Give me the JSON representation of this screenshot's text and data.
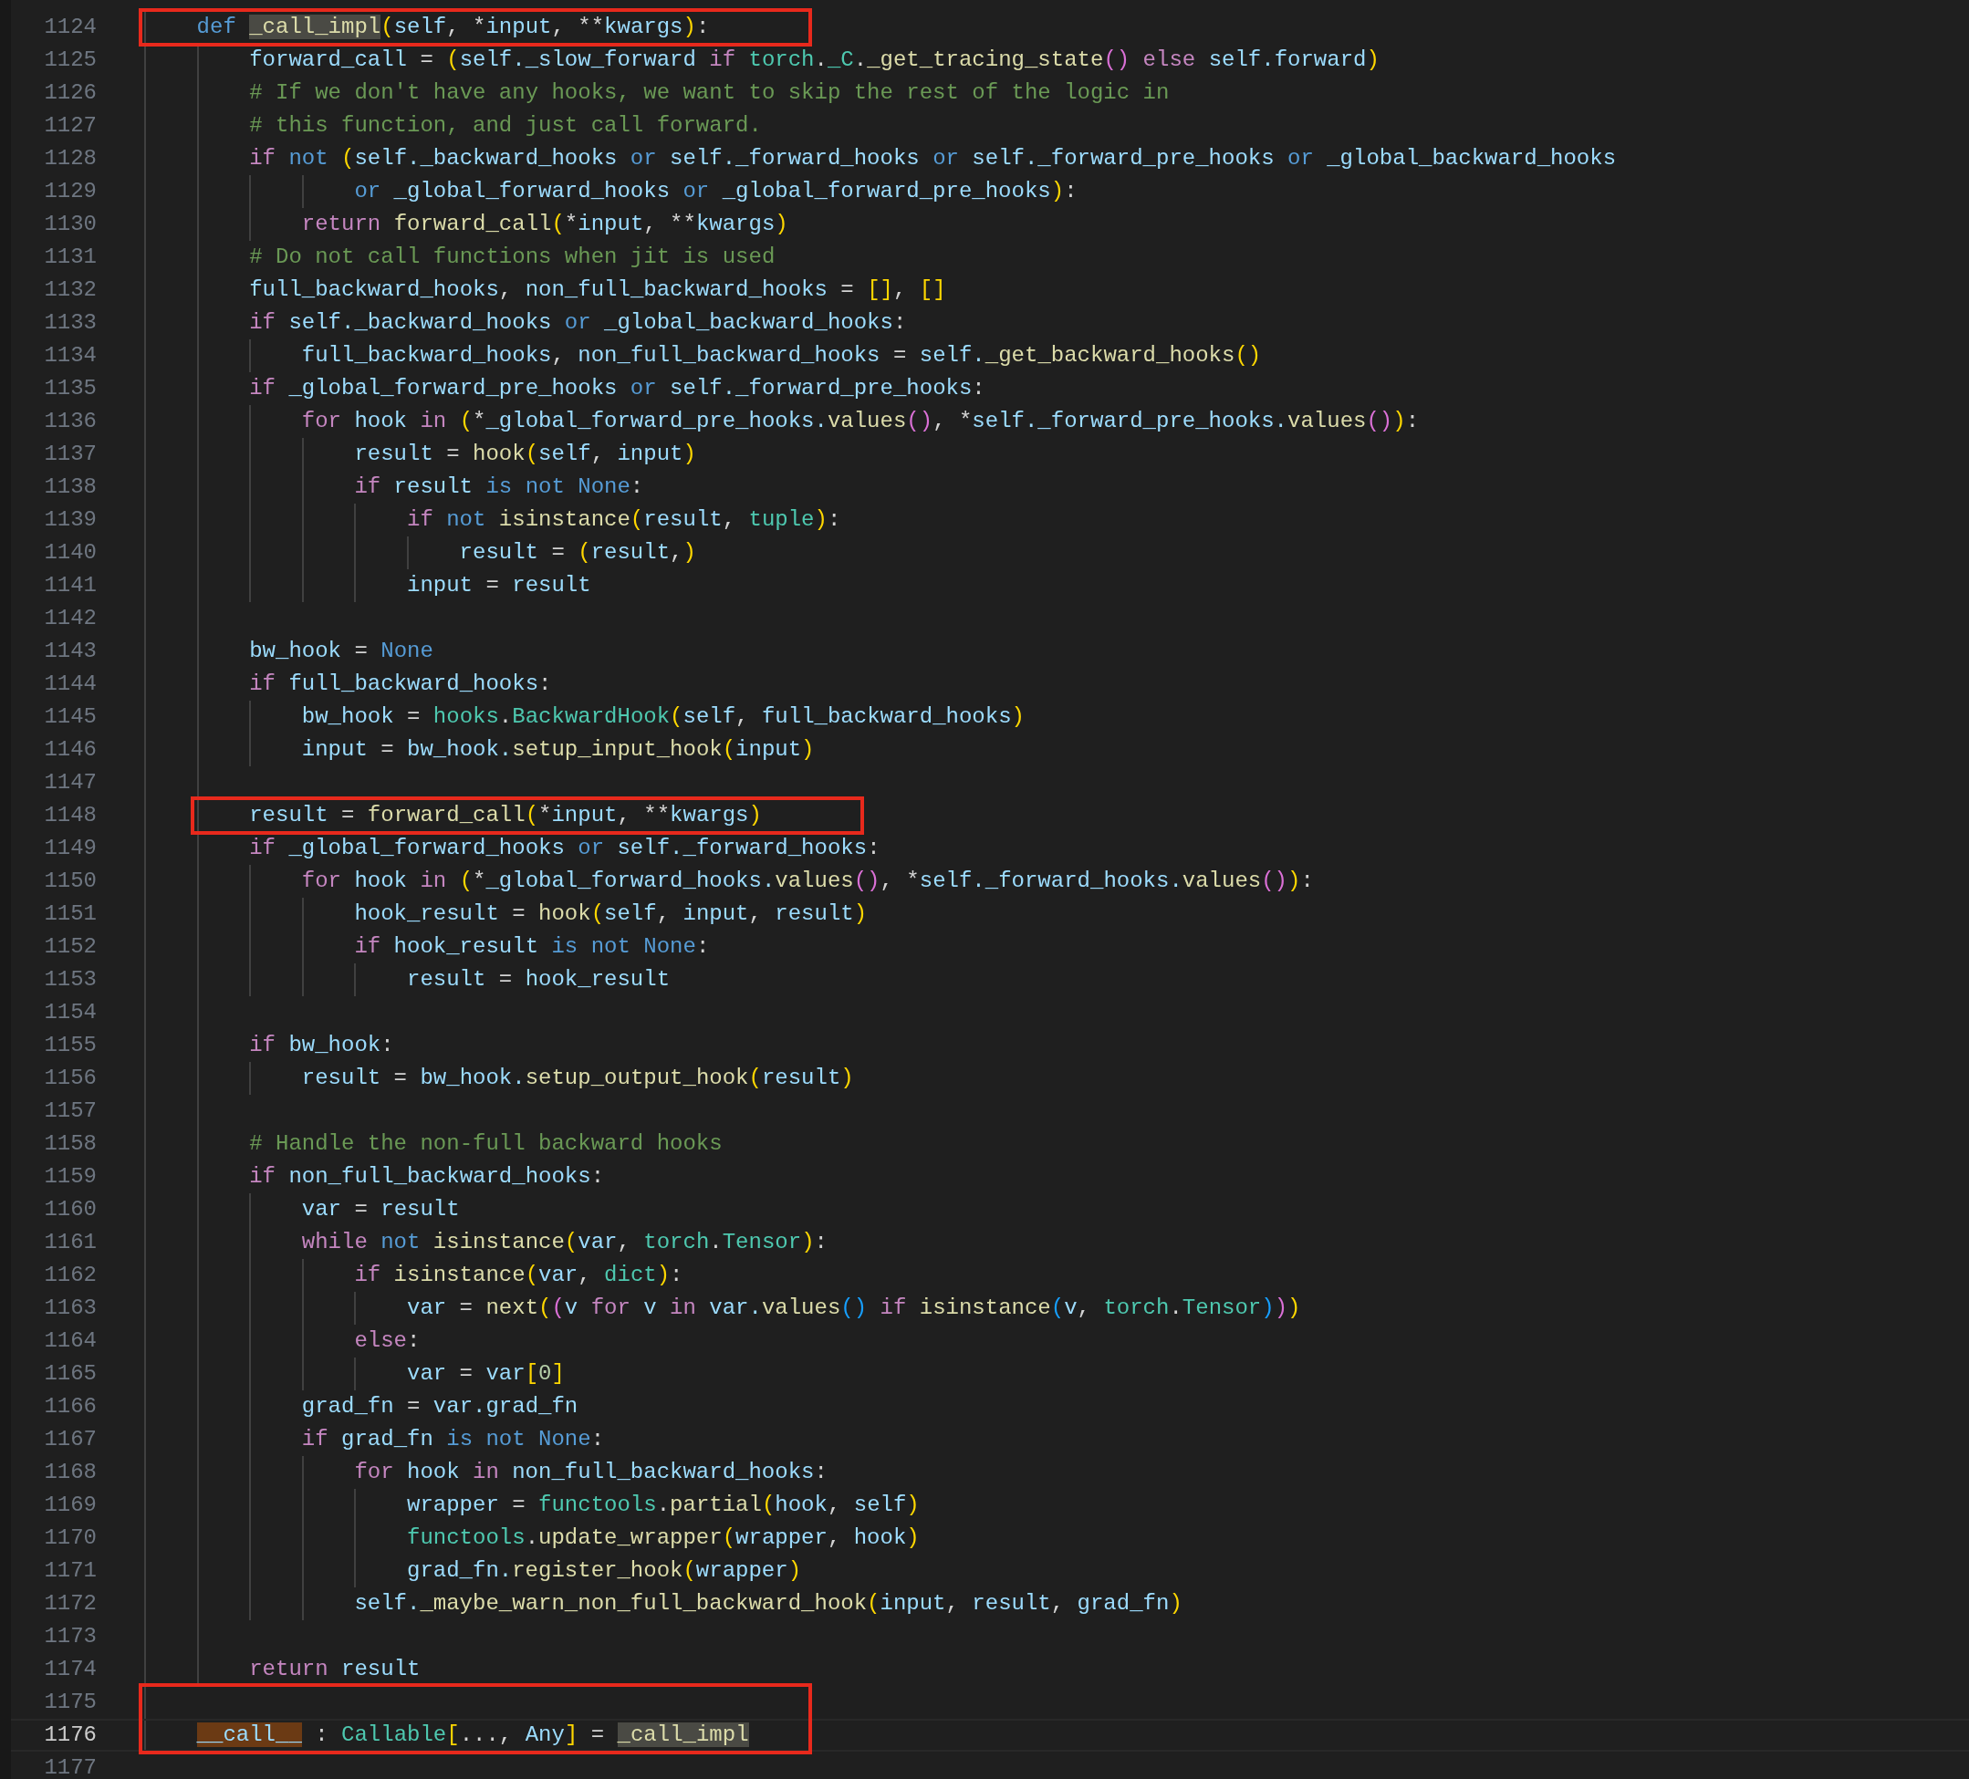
{
  "lines": [
    {
      "number": "1124",
      "boxed": true,
      "segments": [
        {
          "kind": "kwb",
          "text": "    def "
        },
        {
          "kind": "fn",
          "text": "_call_impl",
          "highlighted": true
        },
        {
          "kind": "br",
          "text": "("
        },
        {
          "kind": "var",
          "text": "self"
        },
        {
          "kind": "p",
          "text": ", *"
        },
        {
          "kind": "var",
          "text": "input"
        },
        {
          "kind": "p",
          "text": ", **"
        },
        {
          "kind": "var",
          "text": "kwargs"
        },
        {
          "kind": "br",
          "text": ")"
        },
        {
          "kind": "p",
          "text": ":"
        }
      ]
    },
    {
      "number": "1125",
      "segments": [
        {
          "kind": "var",
          "text": "        forward_call"
        },
        {
          "kind": "p",
          "text": " = "
        },
        {
          "kind": "br",
          "text": "("
        },
        {
          "kind": "var",
          "text": "self._slow_forward"
        },
        {
          "kind": "kw",
          "text": " if "
        },
        {
          "kind": "cls",
          "text": "torch"
        },
        {
          "kind": "p",
          "text": "."
        },
        {
          "kind": "cls",
          "text": "_C"
        },
        {
          "kind": "p",
          "text": "."
        },
        {
          "kind": "fn",
          "text": "_get_tracing_state"
        },
        {
          "kind": "br2",
          "text": "()"
        },
        {
          "kind": "kw",
          "text": " else "
        },
        {
          "kind": "var",
          "text": "self.forward"
        },
        {
          "kind": "br",
          "text": ")"
        }
      ]
    },
    {
      "number": "1126",
      "segments": [
        {
          "kind": "cm",
          "text": "        # If we don't have any hooks, we want to skip the rest of the logic in"
        }
      ]
    },
    {
      "number": "1127",
      "segments": [
        {
          "kind": "cm",
          "text": "        # this function, and just call forward."
        }
      ]
    },
    {
      "number": "1128",
      "segments": [
        {
          "kind": "kw",
          "text": "        if "
        },
        {
          "kind": "kwb",
          "text": "not "
        },
        {
          "kind": "br",
          "text": "("
        },
        {
          "kind": "var",
          "text": "self._backward_hooks"
        },
        {
          "kind": "kwb",
          "text": " or "
        },
        {
          "kind": "var",
          "text": "self._forward_hooks"
        },
        {
          "kind": "kwb",
          "text": " or "
        },
        {
          "kind": "var",
          "text": "self._forward_pre_hooks"
        },
        {
          "kind": "kwb",
          "text": " or "
        },
        {
          "kind": "var",
          "text": "_global_backward_hooks"
        }
      ]
    },
    {
      "number": "1129",
      "segments": [
        {
          "kind": "kwb",
          "text": "                or "
        },
        {
          "kind": "var",
          "text": "_global_forward_hooks"
        },
        {
          "kind": "kwb",
          "text": " or "
        },
        {
          "kind": "var",
          "text": "_global_forward_pre_hooks"
        },
        {
          "kind": "br",
          "text": ")"
        },
        {
          "kind": "p",
          "text": ":"
        }
      ]
    },
    {
      "number": "1130",
      "segments": [
        {
          "kind": "kw",
          "text": "            return "
        },
        {
          "kind": "fn",
          "text": "forward_call"
        },
        {
          "kind": "br",
          "text": "("
        },
        {
          "kind": "p",
          "text": "*"
        },
        {
          "kind": "var",
          "text": "input"
        },
        {
          "kind": "p",
          "text": ", **"
        },
        {
          "kind": "var",
          "text": "kwargs"
        },
        {
          "kind": "br",
          "text": ")"
        }
      ]
    },
    {
      "number": "1131",
      "segments": [
        {
          "kind": "cm",
          "text": "        # Do not call functions when jit is used"
        }
      ]
    },
    {
      "number": "1132",
      "segments": [
        {
          "kind": "var",
          "text": "        full_backward_hooks"
        },
        {
          "kind": "p",
          "text": ", "
        },
        {
          "kind": "var",
          "text": "non_full_backward_hooks"
        },
        {
          "kind": "p",
          "text": " = "
        },
        {
          "kind": "br",
          "text": "[]"
        },
        {
          "kind": "p",
          "text": ", "
        },
        {
          "kind": "br",
          "text": "[]"
        }
      ]
    },
    {
      "number": "1133",
      "segments": [
        {
          "kind": "kw",
          "text": "        if "
        },
        {
          "kind": "var",
          "text": "self._backward_hooks"
        },
        {
          "kind": "kwb",
          "text": " or "
        },
        {
          "kind": "var",
          "text": "_global_backward_hooks"
        },
        {
          "kind": "p",
          "text": ":"
        }
      ]
    },
    {
      "number": "1134",
      "segments": [
        {
          "kind": "var",
          "text": "            full_backward_hooks"
        },
        {
          "kind": "p",
          "text": ", "
        },
        {
          "kind": "var",
          "text": "non_full_backward_hooks"
        },
        {
          "kind": "p",
          "text": " = "
        },
        {
          "kind": "var",
          "text": "self."
        },
        {
          "kind": "fn",
          "text": "_get_backward_hooks"
        },
        {
          "kind": "br",
          "text": "()"
        }
      ]
    },
    {
      "number": "1135",
      "segments": [
        {
          "kind": "kw",
          "text": "        if "
        },
        {
          "kind": "var",
          "text": "_global_forward_pre_hooks"
        },
        {
          "kind": "kwb",
          "text": " or "
        },
        {
          "kind": "var",
          "text": "self._forward_pre_hooks"
        },
        {
          "kind": "p",
          "text": ":"
        }
      ]
    },
    {
      "number": "1136",
      "segments": [
        {
          "kind": "kw",
          "text": "            for "
        },
        {
          "kind": "var",
          "text": "hook"
        },
        {
          "kind": "kw",
          "text": " in "
        },
        {
          "kind": "br",
          "text": "("
        },
        {
          "kind": "p",
          "text": "*"
        },
        {
          "kind": "var",
          "text": "_global_forward_pre_hooks."
        },
        {
          "kind": "fn",
          "text": "values"
        },
        {
          "kind": "br2",
          "text": "()"
        },
        {
          "kind": "p",
          "text": ", *"
        },
        {
          "kind": "var",
          "text": "self._forward_pre_hooks."
        },
        {
          "kind": "fn",
          "text": "values"
        },
        {
          "kind": "br2",
          "text": "()"
        },
        {
          "kind": "br",
          "text": ")"
        },
        {
          "kind": "p",
          "text": ":"
        }
      ]
    },
    {
      "number": "1137",
      "segments": [
        {
          "kind": "var",
          "text": "                result"
        },
        {
          "kind": "p",
          "text": " = "
        },
        {
          "kind": "fn",
          "text": "hook"
        },
        {
          "kind": "br",
          "text": "("
        },
        {
          "kind": "var",
          "text": "self"
        },
        {
          "kind": "p",
          "text": ", "
        },
        {
          "kind": "var",
          "text": "input"
        },
        {
          "kind": "br",
          "text": ")"
        }
      ]
    },
    {
      "number": "1138",
      "segments": [
        {
          "kind": "kw",
          "text": "                if "
        },
        {
          "kind": "var",
          "text": "result"
        },
        {
          "kind": "kwb",
          "text": " is not None"
        },
        {
          "kind": "p",
          "text": ":"
        }
      ]
    },
    {
      "number": "1139",
      "segments": [
        {
          "kind": "kw",
          "text": "                    if "
        },
        {
          "kind": "kwb",
          "text": "not "
        },
        {
          "kind": "fn",
          "text": "isinstance"
        },
        {
          "kind": "br",
          "text": "("
        },
        {
          "kind": "var",
          "text": "result"
        },
        {
          "kind": "p",
          "text": ", "
        },
        {
          "kind": "cls",
          "text": "tuple"
        },
        {
          "kind": "br",
          "text": ")"
        },
        {
          "kind": "p",
          "text": ":"
        }
      ]
    },
    {
      "number": "1140",
      "segments": [
        {
          "kind": "var",
          "text": "                        result"
        },
        {
          "kind": "p",
          "text": " = "
        },
        {
          "kind": "br",
          "text": "("
        },
        {
          "kind": "var",
          "text": "result"
        },
        {
          "kind": "p",
          "text": ","
        },
        {
          "kind": "br",
          "text": ")"
        }
      ]
    },
    {
      "number": "1141",
      "segments": [
        {
          "kind": "var",
          "text": "                    input"
        },
        {
          "kind": "p",
          "text": " = "
        },
        {
          "kind": "var",
          "text": "result"
        }
      ]
    },
    {
      "number": "1142"
    },
    {
      "number": "1143",
      "segments": [
        {
          "kind": "var",
          "text": "        bw_hook"
        },
        {
          "kind": "p",
          "text": " = "
        },
        {
          "kind": "kwb",
          "text": "None"
        }
      ]
    },
    {
      "number": "1144",
      "segments": [
        {
          "kind": "kw",
          "text": "        if "
        },
        {
          "kind": "var",
          "text": "full_backward_hooks"
        },
        {
          "kind": "p",
          "text": ":"
        }
      ]
    },
    {
      "number": "1145",
      "segments": [
        {
          "kind": "var",
          "text": "            bw_hook"
        },
        {
          "kind": "p",
          "text": " = "
        },
        {
          "kind": "cls",
          "text": "hooks"
        },
        {
          "kind": "p",
          "text": "."
        },
        {
          "kind": "cls",
          "text": "BackwardHook"
        },
        {
          "kind": "br",
          "text": "("
        },
        {
          "kind": "var",
          "text": "self"
        },
        {
          "kind": "p",
          "text": ", "
        },
        {
          "kind": "var",
          "text": "full_backward_hooks"
        },
        {
          "kind": "br",
          "text": ")"
        }
      ]
    },
    {
      "number": "1146",
      "segments": [
        {
          "kind": "var",
          "text": "            input"
        },
        {
          "kind": "p",
          "text": " = "
        },
        {
          "kind": "var",
          "text": "bw_hook."
        },
        {
          "kind": "fn",
          "text": "setup_input_hook"
        },
        {
          "kind": "br",
          "text": "("
        },
        {
          "kind": "var",
          "text": "input"
        },
        {
          "kind": "br",
          "text": ")"
        }
      ]
    },
    {
      "number": "1147"
    },
    {
      "number": "1148",
      "boxed": true,
      "segments": [
        {
          "kind": "var",
          "text": "        result"
        },
        {
          "kind": "p",
          "text": " = "
        },
        {
          "kind": "fn",
          "text": "forward_call"
        },
        {
          "kind": "br",
          "text": "("
        },
        {
          "kind": "p",
          "text": "*"
        },
        {
          "kind": "var",
          "text": "input"
        },
        {
          "kind": "p",
          "text": ", **"
        },
        {
          "kind": "var",
          "text": "kwargs"
        },
        {
          "kind": "br",
          "text": ")"
        }
      ]
    },
    {
      "number": "1149",
      "segments": [
        {
          "kind": "kw",
          "text": "        if "
        },
        {
          "kind": "var",
          "text": "_global_forward_hooks"
        },
        {
          "kind": "kwb",
          "text": " or "
        },
        {
          "kind": "var",
          "text": "self._forward_hooks"
        },
        {
          "kind": "p",
          "text": ":"
        }
      ]
    },
    {
      "number": "1150",
      "segments": [
        {
          "kind": "kw",
          "text": "            for "
        },
        {
          "kind": "var",
          "text": "hook"
        },
        {
          "kind": "kw",
          "text": " in "
        },
        {
          "kind": "br",
          "text": "("
        },
        {
          "kind": "p",
          "text": "*"
        },
        {
          "kind": "var",
          "text": "_global_forward_hooks."
        },
        {
          "kind": "fn",
          "text": "values"
        },
        {
          "kind": "br2",
          "text": "()"
        },
        {
          "kind": "p",
          "text": ", *"
        },
        {
          "kind": "var",
          "text": "self._forward_hooks."
        },
        {
          "kind": "fn",
          "text": "values"
        },
        {
          "kind": "br2",
          "text": "()"
        },
        {
          "kind": "br",
          "text": ")"
        },
        {
          "kind": "p",
          "text": ":"
        }
      ]
    },
    {
      "number": "1151",
      "segments": [
        {
          "kind": "var",
          "text": "                hook_result"
        },
        {
          "kind": "p",
          "text": " = "
        },
        {
          "kind": "fn",
          "text": "hook"
        },
        {
          "kind": "br",
          "text": "("
        },
        {
          "kind": "var",
          "text": "self"
        },
        {
          "kind": "p",
          "text": ", "
        },
        {
          "kind": "var",
          "text": "input"
        },
        {
          "kind": "p",
          "text": ", "
        },
        {
          "kind": "var",
          "text": "result"
        },
        {
          "kind": "br",
          "text": ")"
        }
      ]
    },
    {
      "number": "1152",
      "segments": [
        {
          "kind": "kw",
          "text": "                if "
        },
        {
          "kind": "var",
          "text": "hook_result"
        },
        {
          "kind": "kwb",
          "text": " is not None"
        },
        {
          "kind": "p",
          "text": ":"
        }
      ]
    },
    {
      "number": "1153",
      "segments": [
        {
          "kind": "var",
          "text": "                    result"
        },
        {
          "kind": "p",
          "text": " = "
        },
        {
          "kind": "var",
          "text": "hook_result"
        }
      ]
    },
    {
      "number": "1154"
    },
    {
      "number": "1155",
      "segments": [
        {
          "kind": "kw",
          "text": "        if "
        },
        {
          "kind": "var",
          "text": "bw_hook"
        },
        {
          "kind": "p",
          "text": ":"
        }
      ]
    },
    {
      "number": "1156",
      "segments": [
        {
          "kind": "var",
          "text": "            result"
        },
        {
          "kind": "p",
          "text": " = "
        },
        {
          "kind": "var",
          "text": "bw_hook."
        },
        {
          "kind": "fn",
          "text": "setup_output_hook"
        },
        {
          "kind": "br",
          "text": "("
        },
        {
          "kind": "var",
          "text": "result"
        },
        {
          "kind": "br",
          "text": ")"
        }
      ]
    },
    {
      "number": "1157"
    },
    {
      "number": "1158",
      "segments": [
        {
          "kind": "cm",
          "text": "        # Handle the non-full backward hooks"
        }
      ]
    },
    {
      "number": "1159",
      "segments": [
        {
          "kind": "kw",
          "text": "        if "
        },
        {
          "kind": "var",
          "text": "non_full_backward_hooks"
        },
        {
          "kind": "p",
          "text": ":"
        }
      ]
    },
    {
      "number": "1160",
      "segments": [
        {
          "kind": "var",
          "text": "            var"
        },
        {
          "kind": "p",
          "text": " = "
        },
        {
          "kind": "var",
          "text": "result"
        }
      ]
    },
    {
      "number": "1161",
      "segments": [
        {
          "kind": "kw",
          "text": "            while "
        },
        {
          "kind": "kwb",
          "text": "not "
        },
        {
          "kind": "fn",
          "text": "isinstance"
        },
        {
          "kind": "br",
          "text": "("
        },
        {
          "kind": "var",
          "text": "var"
        },
        {
          "kind": "p",
          "text": ", "
        },
        {
          "kind": "cls",
          "text": "torch"
        },
        {
          "kind": "p",
          "text": "."
        },
        {
          "kind": "cls",
          "text": "Tensor"
        },
        {
          "kind": "br",
          "text": ")"
        },
        {
          "kind": "p",
          "text": ":"
        }
      ]
    },
    {
      "number": "1162",
      "segments": [
        {
          "kind": "kw",
          "text": "                if "
        },
        {
          "kind": "fn",
          "text": "isinstance"
        },
        {
          "kind": "br",
          "text": "("
        },
        {
          "kind": "var",
          "text": "var"
        },
        {
          "kind": "p",
          "text": ", "
        },
        {
          "kind": "cls",
          "text": "dict"
        },
        {
          "kind": "br",
          "text": ")"
        },
        {
          "kind": "p",
          "text": ":"
        }
      ]
    },
    {
      "number": "1163",
      "segments": [
        {
          "kind": "var",
          "text": "                    var"
        },
        {
          "kind": "p",
          "text": " = "
        },
        {
          "kind": "fn",
          "text": "next"
        },
        {
          "kind": "br",
          "text": "("
        },
        {
          "kind": "br2",
          "text": "("
        },
        {
          "kind": "var",
          "text": "v"
        },
        {
          "kind": "kw",
          "text": " for "
        },
        {
          "kind": "var",
          "text": "v"
        },
        {
          "kind": "kw",
          "text": " in "
        },
        {
          "kind": "var",
          "text": "var."
        },
        {
          "kind": "fn",
          "text": "values"
        },
        {
          "kind": "br3",
          "text": "()"
        },
        {
          "kind": "kw",
          "text": " if "
        },
        {
          "kind": "fn",
          "text": "isinstance"
        },
        {
          "kind": "br3",
          "text": "("
        },
        {
          "kind": "var",
          "text": "v"
        },
        {
          "kind": "p",
          "text": ", "
        },
        {
          "kind": "cls",
          "text": "torch"
        },
        {
          "kind": "p",
          "text": "."
        },
        {
          "kind": "cls",
          "text": "Tensor"
        },
        {
          "kind": "br3",
          "text": ")"
        },
        {
          "kind": "br2",
          "text": ")"
        },
        {
          "kind": "br",
          "text": ")"
        }
      ]
    },
    {
      "number": "1164",
      "segments": [
        {
          "kind": "kw",
          "text": "                else"
        },
        {
          "kind": "p",
          "text": ":"
        }
      ]
    },
    {
      "number": "1165",
      "segments": [
        {
          "kind": "var",
          "text": "                    var"
        },
        {
          "kind": "p",
          "text": " = "
        },
        {
          "kind": "var",
          "text": "var"
        },
        {
          "kind": "br",
          "text": "["
        },
        {
          "kind": "num",
          "text": "0"
        },
        {
          "kind": "br",
          "text": "]"
        }
      ]
    },
    {
      "number": "1166",
      "segments": [
        {
          "kind": "var",
          "text": "            grad_fn"
        },
        {
          "kind": "p",
          "text": " = "
        },
        {
          "kind": "var",
          "text": "var.grad_fn"
        }
      ]
    },
    {
      "number": "1167",
      "segments": [
        {
          "kind": "kw",
          "text": "            if "
        },
        {
          "kind": "var",
          "text": "grad_fn"
        },
        {
          "kind": "kwb",
          "text": " is not None"
        },
        {
          "kind": "p",
          "text": ":"
        }
      ]
    },
    {
      "number": "1168",
      "segments": [
        {
          "kind": "kw",
          "text": "                for "
        },
        {
          "kind": "var",
          "text": "hook"
        },
        {
          "kind": "kw",
          "text": " in "
        },
        {
          "kind": "var",
          "text": "non_full_backward_hooks"
        },
        {
          "kind": "p",
          "text": ":"
        }
      ]
    },
    {
      "number": "1169",
      "segments": [
        {
          "kind": "var",
          "text": "                    wrapper"
        },
        {
          "kind": "p",
          "text": " = "
        },
        {
          "kind": "cls",
          "text": "functools"
        },
        {
          "kind": "p",
          "text": "."
        },
        {
          "kind": "fn",
          "text": "partial"
        },
        {
          "kind": "br",
          "text": "("
        },
        {
          "kind": "var",
          "text": "hook"
        },
        {
          "kind": "p",
          "text": ", "
        },
        {
          "kind": "var",
          "text": "self"
        },
        {
          "kind": "br",
          "text": ")"
        }
      ]
    },
    {
      "number": "1170",
      "segments": [
        {
          "kind": "cls",
          "text": "                    functools"
        },
        {
          "kind": "p",
          "text": "."
        },
        {
          "kind": "fn",
          "text": "update_wrapper"
        },
        {
          "kind": "br",
          "text": "("
        },
        {
          "kind": "var",
          "text": "wrapper"
        },
        {
          "kind": "p",
          "text": ", "
        },
        {
          "kind": "var",
          "text": "hook"
        },
        {
          "kind": "br",
          "text": ")"
        }
      ]
    },
    {
      "number": "1171",
      "segments": [
        {
          "kind": "var",
          "text": "                    grad_fn."
        },
        {
          "kind": "fn",
          "text": "register_hook"
        },
        {
          "kind": "br",
          "text": "("
        },
        {
          "kind": "var",
          "text": "wrapper"
        },
        {
          "kind": "br",
          "text": ")"
        }
      ]
    },
    {
      "number": "1172",
      "segments": [
        {
          "kind": "var",
          "text": "                self."
        },
        {
          "kind": "fn",
          "text": "_maybe_warn_non_full_backward_hook"
        },
        {
          "kind": "br",
          "text": "("
        },
        {
          "kind": "var",
          "text": "input"
        },
        {
          "kind": "p",
          "text": ", "
        },
        {
          "kind": "var",
          "text": "result"
        },
        {
          "kind": "p",
          "text": ", "
        },
        {
          "kind": "var",
          "text": "grad_fn"
        },
        {
          "kind": "br",
          "text": ")"
        }
      ]
    },
    {
      "number": "1173"
    },
    {
      "number": "1174",
      "segments": [
        {
          "kind": "kw",
          "text": "        return "
        },
        {
          "kind": "var",
          "text": "result"
        }
      ]
    },
    {
      "number": "1175",
      "boxed": true
    },
    {
      "number": "1176",
      "boxed": true,
      "current": true,
      "segments": [
        {
          "kind": "var",
          "text": "    __call__",
          "highlighted": true
        },
        {
          "kind": "p",
          "text": " : "
        },
        {
          "kind": "cls",
          "text": "Callable"
        },
        {
          "kind": "br",
          "text": "["
        },
        {
          "kind": "p",
          "text": "..., "
        },
        {
          "kind": "var",
          "text": "Any"
        },
        {
          "kind": "br",
          "text": "]"
        },
        {
          "kind": "p",
          "text": " = "
        },
        {
          "kind": "fn",
          "text": "_call_impl",
          "highlighted": true
        }
      ]
    },
    {
      "number": "1177"
    }
  ]
}
